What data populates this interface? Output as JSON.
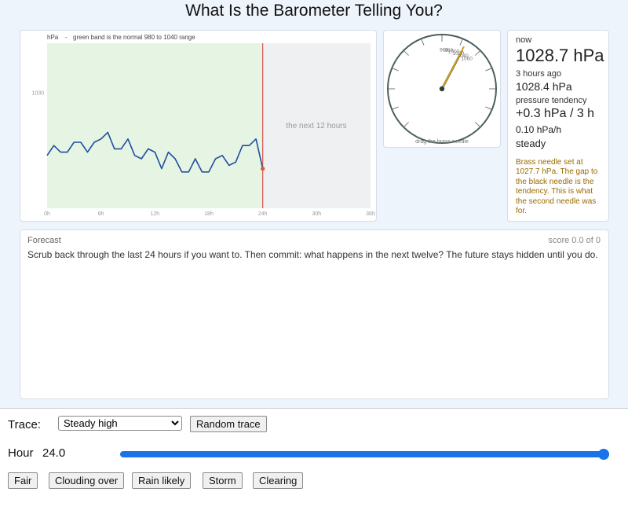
{
  "page": {
    "title": "What Is the Barometer Telling You?"
  },
  "chart": {
    "unit_label": "hPa",
    "separator": "-",
    "band_note": "green band is the normal 980 to 1040 range",
    "future_label": "the next 12 hours",
    "colors": {
      "band": "#e6f4e4",
      "future": "#eef0f1",
      "line": "#1f4e9e",
      "now_line": "#d9534f",
      "marker": "#e05a2b"
    }
  },
  "chart_data": {
    "type": "line",
    "x": [
      0,
      0.75,
      1.5,
      2.25,
      3,
      3.75,
      4.5,
      5.25,
      6,
      6.75,
      7.5,
      8.25,
      9,
      9.75,
      10.5,
      11.25,
      12,
      12.75,
      13.5,
      14.25,
      15,
      15.75,
      16.5,
      17.25,
      18,
      18.75,
      19.5,
      20.25,
      21,
      21.75,
      22.5,
      23.25,
      24
    ],
    "y": [
      1028.1,
      1028.4,
      1028.2,
      1028.2,
      1028.5,
      1028.5,
      1028.2,
      1028.5,
      1028.6,
      1028.8,
      1028.3,
      1028.3,
      1028.6,
      1028.1,
      1028.0,
      1028.3,
      1028.2,
      1027.7,
      1028.2,
      1028.0,
      1027.6,
      1027.6,
      1028.0,
      1027.6,
      1027.6,
      1028.0,
      1028.1,
      1027.8,
      1027.9,
      1028.4,
      1028.4,
      1028.6,
      1027.7
    ],
    "x_ticks": [
      "0h",
      "6h",
      "12h",
      "18h",
      "24h",
      "30h",
      "36h"
    ],
    "y_ticks": [
      "1030"
    ],
    "xlim": [
      0,
      36
    ],
    "ylim": [
      1026.5,
      1031.5
    ],
    "now_hour": 24,
    "normal_range": [
      980,
      1040
    ]
  },
  "gauge": {
    "labels": [
      {
        "text": "1000",
        "value": 1000
      },
      {
        "text": "1020",
        "value": 1020
      },
      {
        "text": "980",
        "value": 980
      },
      {
        "text": "1040",
        "value": 1040
      },
      {
        "text": "960",
        "value": 960
      },
      {
        "text": "1060",
        "value": 1060
      }
    ],
    "brass_value": 1027.7,
    "black_value": 1028.4,
    "drag_hint": "drag the brass needle",
    "colors": {
      "brass": "#d4a017",
      "black": "#2c3e3e",
      "rim": "#4a5f5f"
    }
  },
  "readout": {
    "now_label": "now",
    "now_value": "1028.7 hPa",
    "ago_label": "3 hours ago",
    "ago_value": "1028.4 hPa",
    "tendency_label": "pressure tendency",
    "tendency_value": "+0.3 hPa / 3 h",
    "rate": "0.10 hPa/h",
    "trend": "steady",
    "note": "Brass needle set at 1027.7 hPa. The gap to the black needle is the tendency. This is what the second needle was for."
  },
  "forecast": {
    "label": "Forecast",
    "score": "score 0.0 of 0",
    "text": "Scrub back through the last 24 hours if you want to. Then commit: what happens in the next twelve? The future stays hidden until you do."
  },
  "controls": {
    "trace_label": "Trace:",
    "trace_selected": "Steady high",
    "random_label": "Random trace",
    "hour_label": "Hour",
    "hour_value": "24.0",
    "hour_fraction": 1.0,
    "buttons": [
      "Fair",
      "Clouding over",
      "Rain likely",
      "Storm",
      "Clearing"
    ],
    "accent": "#1a73e8"
  }
}
